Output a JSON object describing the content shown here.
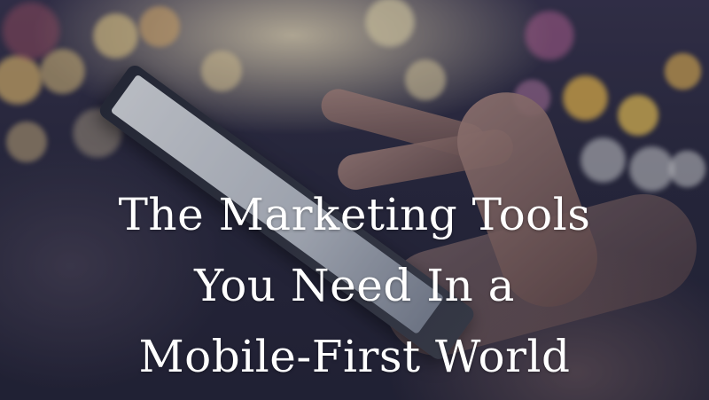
{
  "title": {
    "lines": [
      "The Marketing Tools",
      "You Need In a",
      "Mobile-First World"
    ]
  },
  "colors": {
    "text": "#ffffff",
    "background": "#2b2a40"
  }
}
